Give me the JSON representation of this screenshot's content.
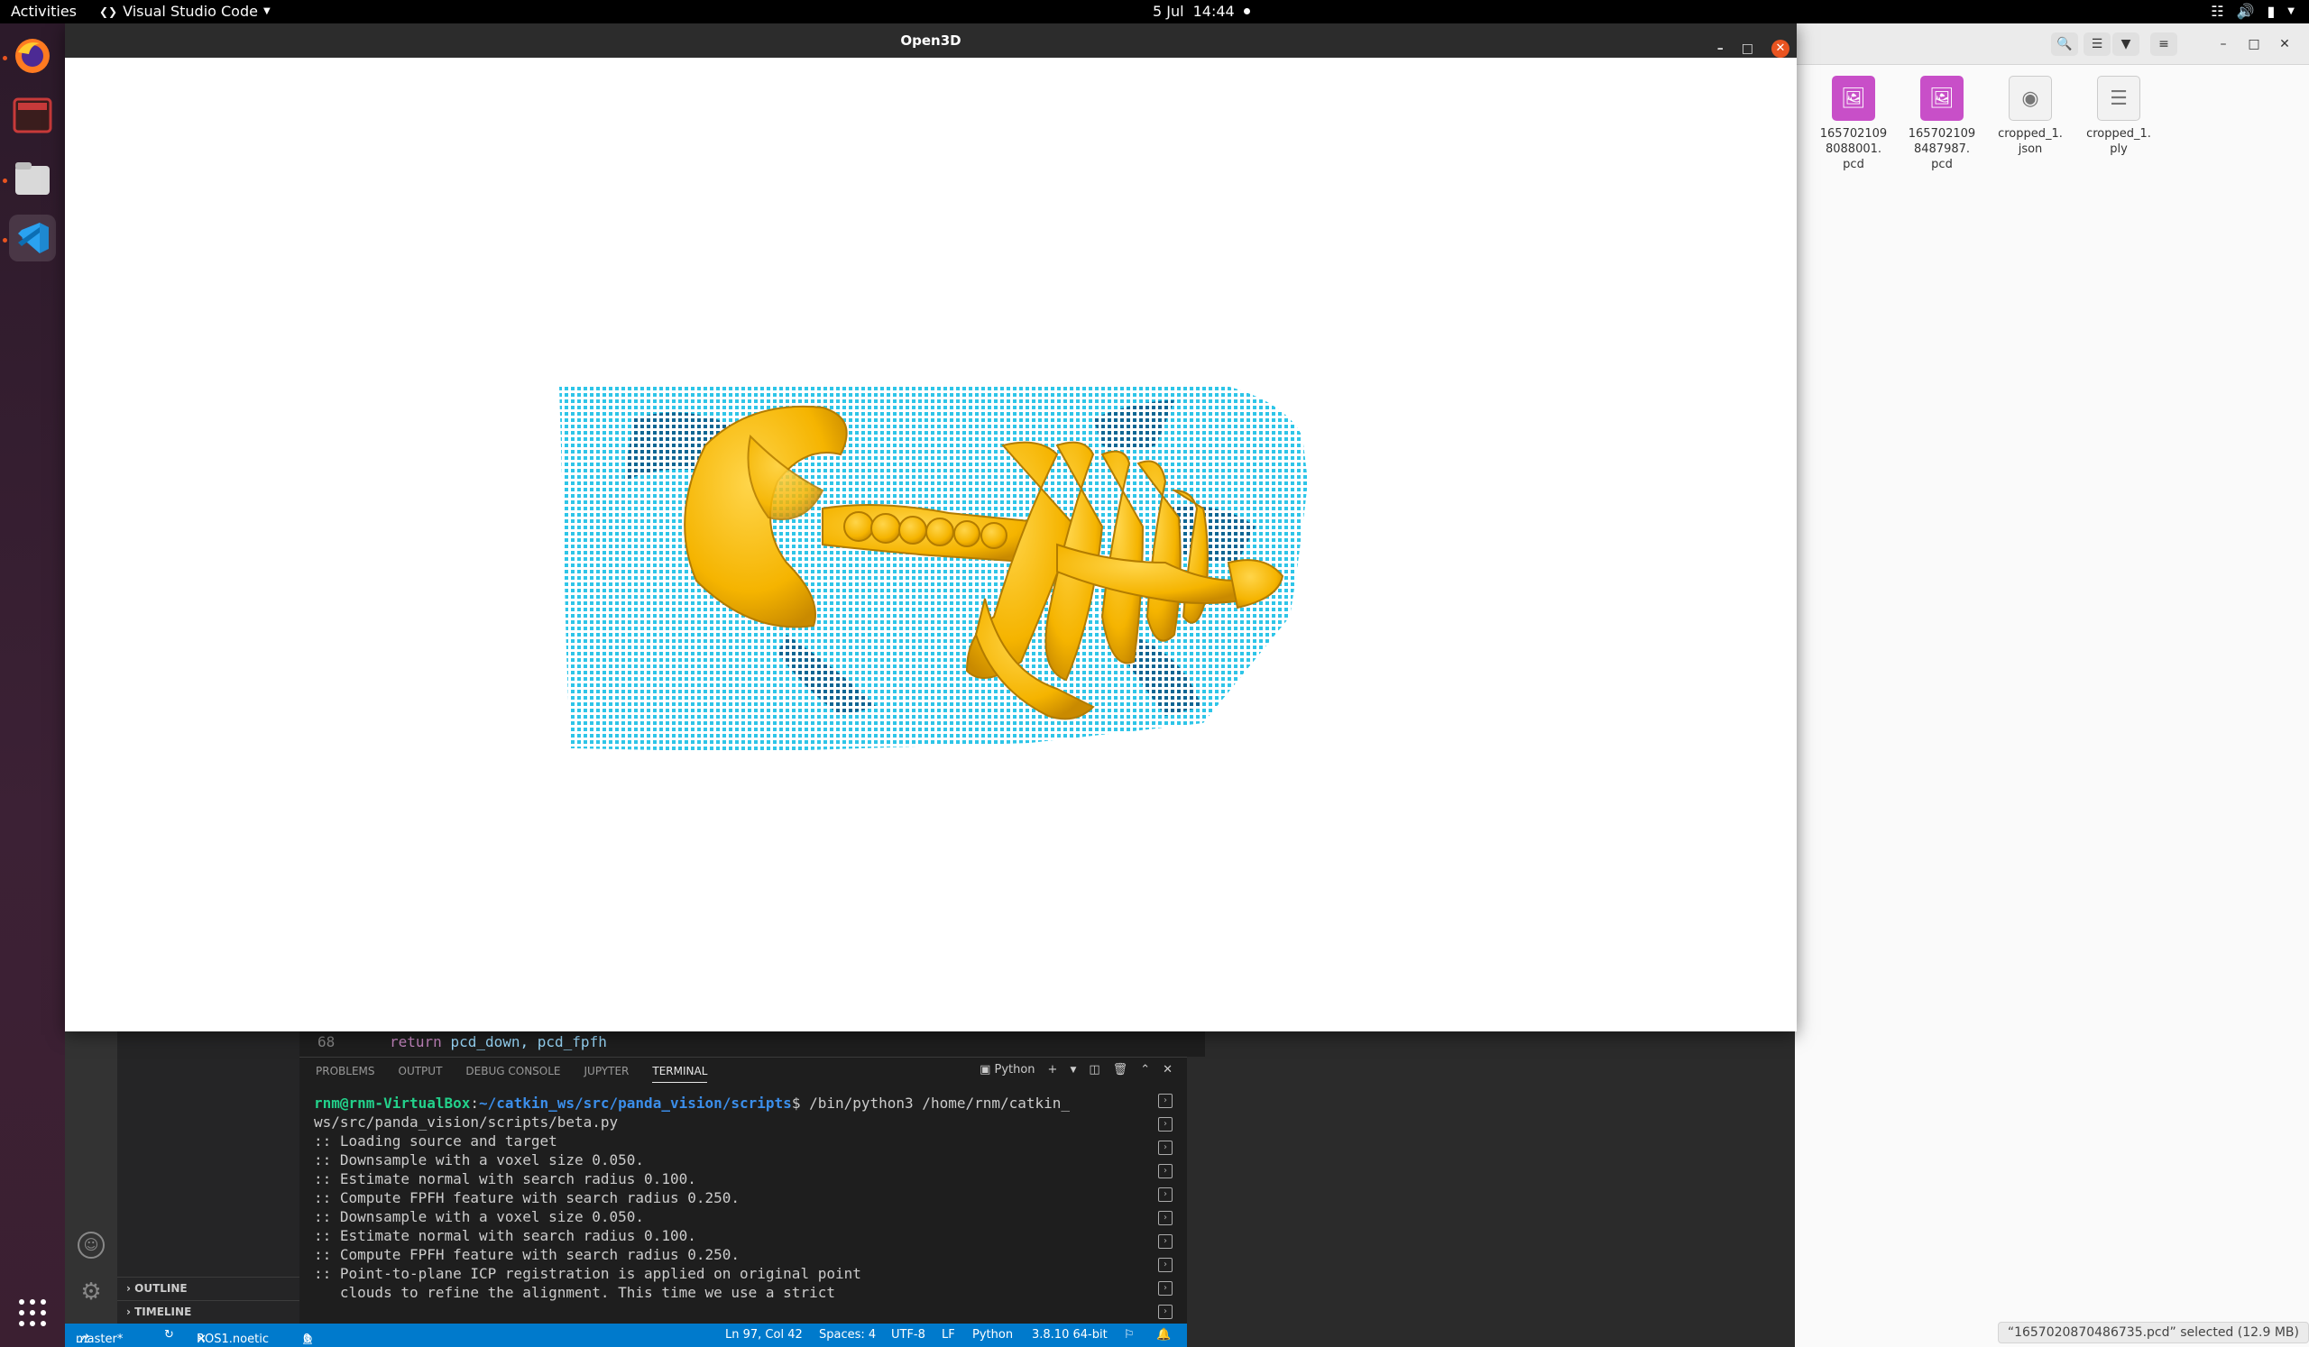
{
  "topbar": {
    "activities": "Activities",
    "app_name": "Visual Studio Code",
    "date": "5 Jul",
    "time": "14:44"
  },
  "dock": {
    "items": [
      "firefox-icon",
      "terminal-icon",
      "files-icon",
      "vscode-icon",
      "app-grid-icon"
    ]
  },
  "open3d": {
    "title": "Open3D"
  },
  "files": {
    "items": [
      {
        "name": "165702109\n8088001.\npcd",
        "type": "image"
      },
      {
        "name": "165702109\n8487987.\npcd",
        "type": "image"
      },
      {
        "name": "cropped_1.\njson",
        "type": "json"
      },
      {
        "name": "cropped_1.\nply",
        "type": "text"
      }
    ],
    "status": "“1657020870486735.pcd” selected  (12.9 MB)"
  },
  "vscode": {
    "editor": {
      "line_number": "68",
      "keyword": "return",
      "code": "pcd_down, pcd_fpfh"
    },
    "sidebar": {
      "outline": "OUTLINE",
      "timeline": "TIMELINE"
    },
    "panel_tabs": [
      "PROBLEMS",
      "OUTPUT",
      "DEBUG CONSOLE",
      "JUPYTER",
      "TERMINAL"
    ],
    "terminal_profile": "Python",
    "terminal": {
      "user": "rnm@rnm-VirtualBox",
      "path": "~/catkin_ws/src/panda_vision/scripts",
      "command": "$ /bin/python3 /home/rnm/catkin_\nws/src/panda_vision/scripts/beta.py",
      "lines": [
        ":: Loading source and target",
        ":: Downsample with a voxel size 0.050.",
        ":: Estimate normal with search radius 0.100.",
        ":: Compute FPFH feature with search radius 0.250.",
        ":: Downsample with a voxel size 0.050.",
        ":: Estimate normal with search radius 0.100.",
        ":: Compute FPFH feature with search radius 0.250.",
        ":: Point-to-plane ICP registration is applied on original point",
        "   clouds to refine the alignment. This time we use a strict"
      ]
    },
    "status": {
      "branch": "master*",
      "ros": "ROS1.noetic",
      "errors": "0",
      "warnings": "0",
      "position": "Ln 97, Col 42",
      "spaces": "Spaces: 4",
      "encoding": "UTF-8",
      "eol": "LF",
      "language": "Python",
      "interpreter": "3.8.10 64-bit"
    }
  },
  "colors": {
    "bone": "#f5b400",
    "cloud_light": "#2ec5e8",
    "cloud_dark": "#0a5c8a",
    "vscode_status": "#007acc",
    "ubuntu_orange": "#e95420"
  }
}
